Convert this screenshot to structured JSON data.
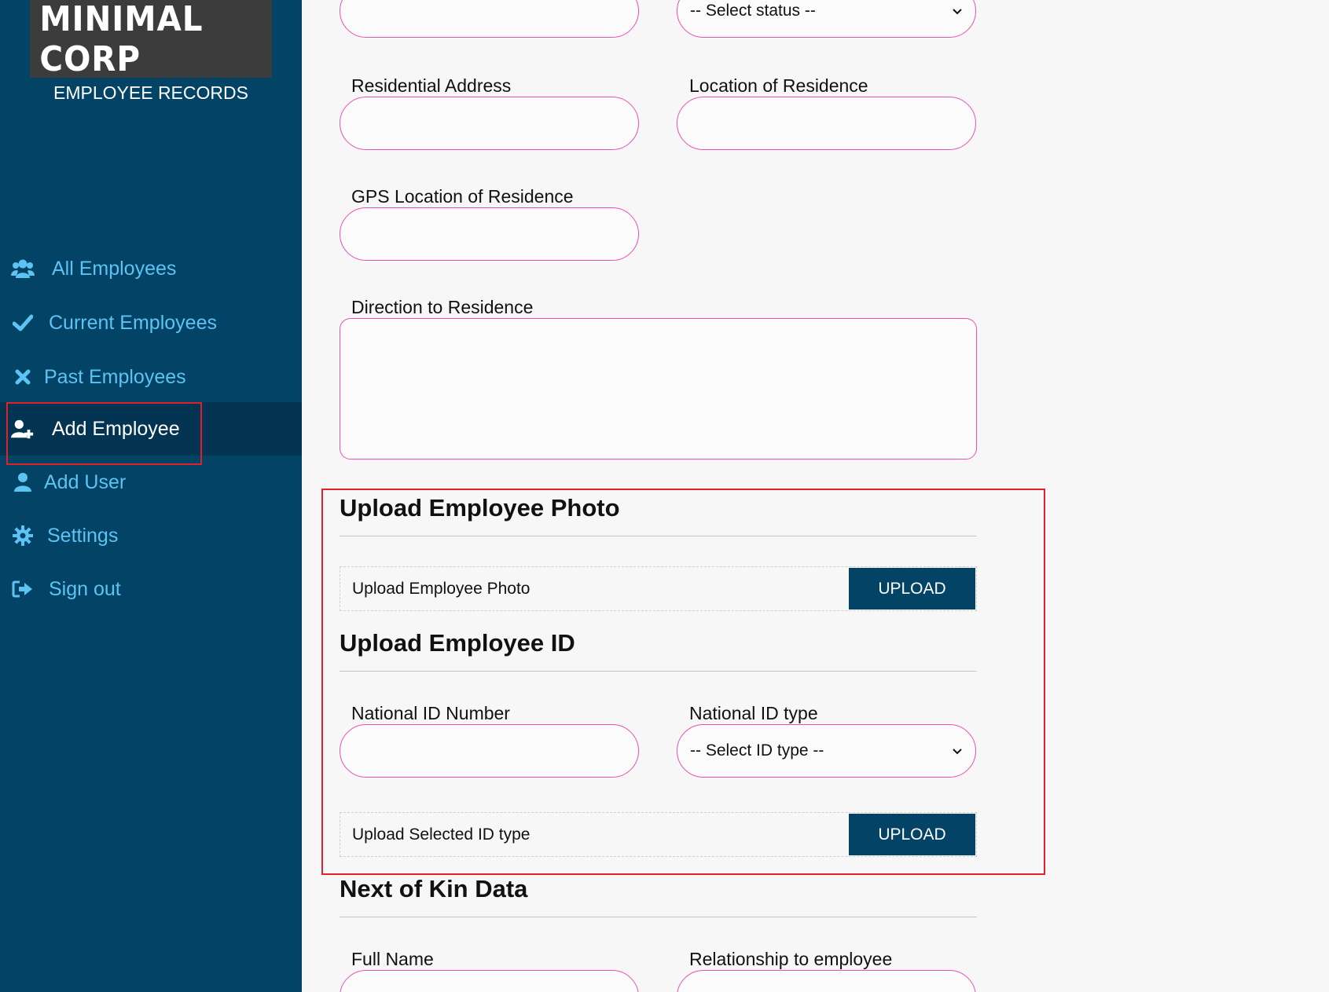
{
  "sidebar": {
    "logo_text": "MINIMAL CORP",
    "subtitle": "EMPLOYEE RECORDS",
    "items": [
      {
        "label": "All Employees",
        "icon": "users-icon"
      },
      {
        "label": "Current Employees",
        "icon": "check-icon"
      },
      {
        "label": "Past Employees",
        "icon": "times-icon"
      },
      {
        "label": "Add Employee",
        "icon": "user-plus-icon",
        "active": true
      },
      {
        "label": "Add User",
        "icon": "user-icon"
      },
      {
        "label": "Settings",
        "icon": "gear-icon"
      },
      {
        "label": "Sign out",
        "icon": "sign-out-icon"
      }
    ]
  },
  "form": {
    "status_select": {
      "selected": "-- Select status --"
    },
    "residential_address": {
      "label": "Residential Address",
      "value": ""
    },
    "location_of_residence": {
      "label": "Location of Residence",
      "value": ""
    },
    "gps_location": {
      "label": "GPS Location of Residence",
      "value": ""
    },
    "direction_to_residence": {
      "label": "Direction to Residence",
      "value": ""
    },
    "upload_photo_section": {
      "title": "Upload Employee Photo",
      "row_label": "Upload Employee Photo",
      "button": "UPLOAD"
    },
    "upload_id_section": {
      "title": "Upload Employee ID",
      "national_id_number": {
        "label": "National ID Number",
        "value": ""
      },
      "national_id_type": {
        "label": "National ID type",
        "selected": "-- Select ID type --"
      },
      "row_label": "Upload Selected ID type",
      "button": "UPLOAD"
    },
    "next_of_kin_section": {
      "title": "Next of Kin Data",
      "full_name": {
        "label": "Full Name"
      },
      "relationship": {
        "label": "Relationship to employee"
      }
    }
  },
  "colors": {
    "sidebar_bg": "#034366",
    "sidebar_active_bg": "#033452",
    "nav_text": "#5cc3f2",
    "input_border": "#ea4fb4",
    "button_bg": "#034366",
    "highlight": "#e0202a"
  }
}
